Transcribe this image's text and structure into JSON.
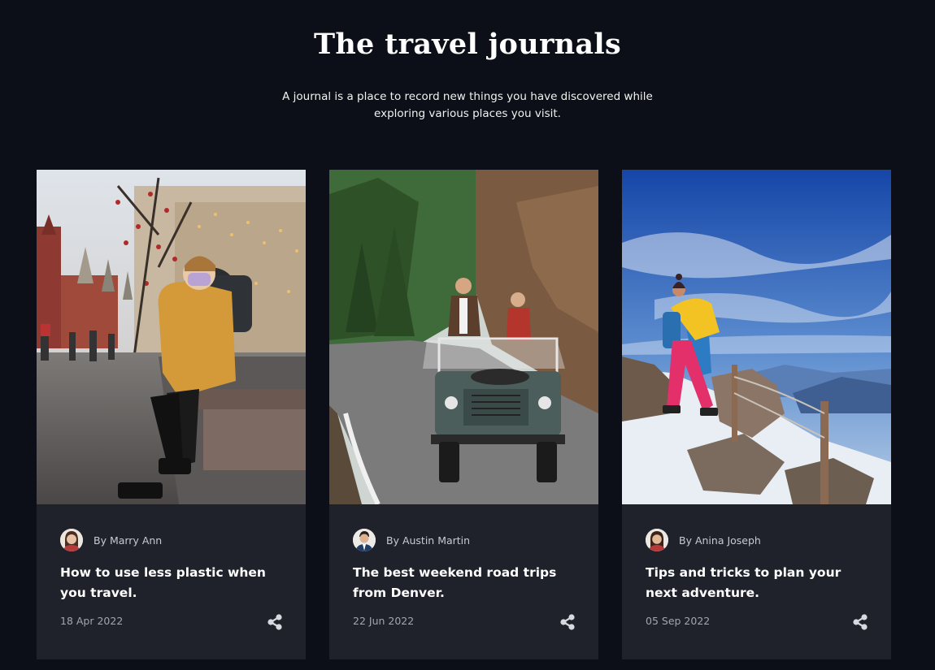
{
  "header": {
    "title": "The travel journals",
    "subtitle": "A journal is a place to record new things you have discovered while exploring various places you visit."
  },
  "cards": [
    {
      "author": "By Marry Ann",
      "title": "How to use less plastic when you travel.",
      "date": "18 Apr 2022",
      "image_icon": "city-street-photo",
      "avatar_icon": "woman-avatar"
    },
    {
      "author": "By Austin Martin",
      "title": "The best weekend road trips from Denver.",
      "date": "22 Jun 2022",
      "image_icon": "road-trip-jeep-photo",
      "avatar_icon": "man-avatar"
    },
    {
      "author": "By Anina Joseph",
      "title": "Tips and tricks to plan your next adventure.",
      "date": "05 Sep 2022",
      "image_icon": "mountain-hiker-photo",
      "avatar_icon": "woman-avatar"
    }
  ],
  "colors": {
    "background": "#0c0f17",
    "card_background": "#1f212b",
    "share_icon": "#d8d9de"
  }
}
